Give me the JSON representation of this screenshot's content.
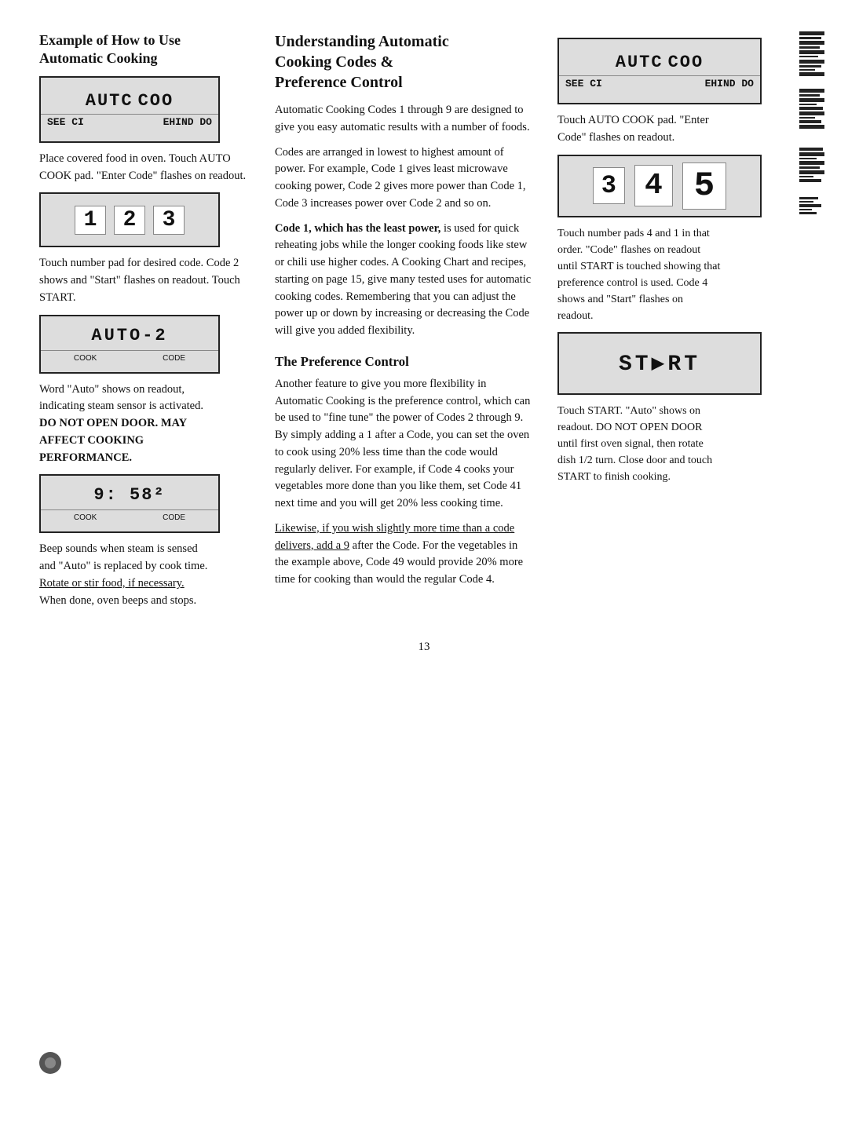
{
  "page": {
    "number": "13"
  },
  "left_col": {
    "title_line1": "Example of How to Use",
    "title_line2": "Automatic Cooking",
    "panel1": {
      "top": "AUTC",
      "mid": "COO",
      "bot_left": "SEE CI",
      "bot_right": "EHIND DO"
    },
    "desc1": "Place covered food in oven. Touch AUTO COOK pad. \"Enter Code\" flashes on readout.",
    "panel2": {
      "nums": [
        "1",
        "2",
        "3"
      ]
    },
    "desc2": "Touch number pad for desired code. Code 2 shows and \"Start\" flashes on readout. Touch START.",
    "panel3": {
      "text": "AUTO-2",
      "bot_left": "COOK",
      "bot_right": "CODE"
    },
    "desc3_line1": "Word \"Auto\" shows on readout,",
    "desc3_line2": "indicating steam sensor is activated.",
    "desc3_line3": "DO NOT OPEN DOOR. MAY",
    "desc3_line4": "AFFECT COOKING",
    "desc3_line5": "PERFORMANCE.",
    "panel4": {
      "text": "9:58²",
      "bot_left": "COOK",
      "bot_right": "CODE"
    },
    "desc4_line1": "Beep sounds when steam is sensed",
    "desc4_line2": "and \"Auto\" is replaced by cook time.",
    "desc4_line3": "Rotate or stir food, if necessary.",
    "desc4_line4": "When done, oven beeps and stops."
  },
  "middle_col": {
    "title_line1": "Understanding Automatic",
    "title_line2": "Cooking Codes &",
    "title_line3": "Preference Control",
    "body1": "Automatic Cooking Codes 1 through 9 are designed to give you easy automatic results with a number of foods.",
    "body2": "Codes are arranged in lowest to highest amount of power. For example, Code 1 gives least microwave cooking power, Code 2 gives more power than Code 1, Code 3 increases power over Code 2 and so on.",
    "body3_bold_start": "Code 1, which has the least power,",
    "body3": "is used for quick reheating jobs while the longer cooking foods like stew or chili use higher codes. A Cooking Chart and recipes, starting on page 15, give many tested uses for automatic cooking codes. Remembering that you can adjust the power up or down by increasing or decreasing the Code will give you added flexibility.",
    "pref_title": "The Preference Control",
    "pref_body1": "Another feature to give you more flexibility in Automatic Cooking is the preference control, which can be used to \"fine tune\" the power of Codes 2 through 9. By simply adding a 1 after a Code, you can set the oven to cook using 20% less time than the code would regularly deliver. For example, if Code 4 cooks your vegetables more done than you like them, set Code 41 next time and you will get 20% less cooking time.",
    "pref_body2": "Likewise, if you wish slightly more time than a code delivers, add a 9 after the Code. For the vegetables in the example above, Code 49 would provide 20% more time for cooking than would the regular Code 4."
  },
  "right_col": {
    "panel1": {
      "top": "AUTC",
      "mid": "COO",
      "bot_left": "SEE CI",
      "bot_right": "EHIND DO"
    },
    "desc1_line1": "Touch AUTO COOK pad. \"Enter",
    "desc1_line2": "Code\" flashes on readout.",
    "panel2": {
      "nums": [
        "3",
        "4",
        "5"
      ]
    },
    "desc2_line1": "Touch number pads 4 and 1 in that",
    "desc2_line2": "order. \"Code\" flashes on readout",
    "desc2_line3": "until START is touched showing that",
    "desc2_line4": "preference control is used. Code 4",
    "desc2_line5": "shows and \"Start\" flashes on",
    "desc2_line6": "readout.",
    "panel3": {
      "text": "START"
    },
    "desc3_line1": "Touch START. \"Auto\" shows on",
    "desc3_line2": "readout. DO NOT OPEN DOOR",
    "desc3_line3": "until first oven signal, then rotate",
    "desc3_line4": "dish 1/2 turn. Close door and touch",
    "desc3_line5": "START to finish cooking."
  }
}
